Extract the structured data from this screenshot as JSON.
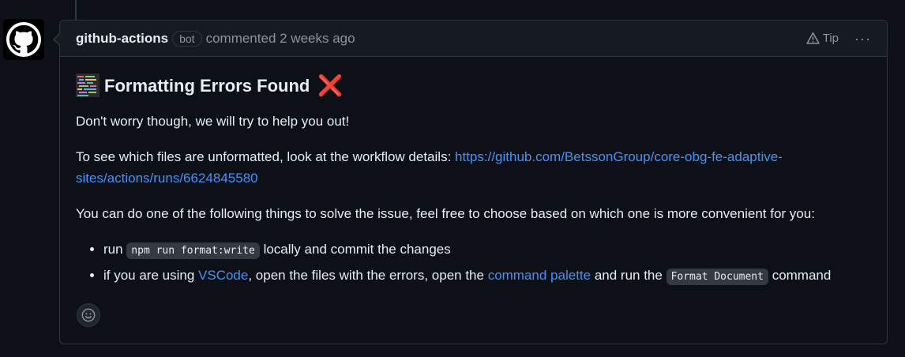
{
  "comment": {
    "author": "github-actions",
    "badge": "bot",
    "commented_text": "commented 2 weeks ago",
    "tip_label": "Tip",
    "more_label": "···",
    "heading": "Formatting Errors Found",
    "heading_icon": "code-lines-icon",
    "heading_emoji": "❌",
    "para1": "Don't worry though, we will try to help you out!",
    "para2_prefix": "To see which files are unformatted, look at the workflow details: ",
    "para2_link": "https://github.com/BetssonGroup/core-obg-fe-adaptive-sites/actions/runs/6624845580",
    "para3": "You can do one of the following things to solve the issue, feel free to choose based on which one is more convenient for you:",
    "item1": {
      "prefix": "run ",
      "code": "npm run format:write",
      "suffix": " locally and commit the changes"
    },
    "item2": {
      "prefix": "if you are using ",
      "link1": "VSCode",
      "middle": ", open the files with the errors, open the ",
      "link2": "command palette",
      "middle2": " and run the ",
      "code": "Format Document",
      "suffix": " command"
    }
  },
  "colors": {
    "background": "#0d1117",
    "header_bg": "#161b22",
    "border": "#30363d",
    "link": "#4493f8",
    "muted": "#8b949e",
    "error_red": "#f0254e"
  }
}
